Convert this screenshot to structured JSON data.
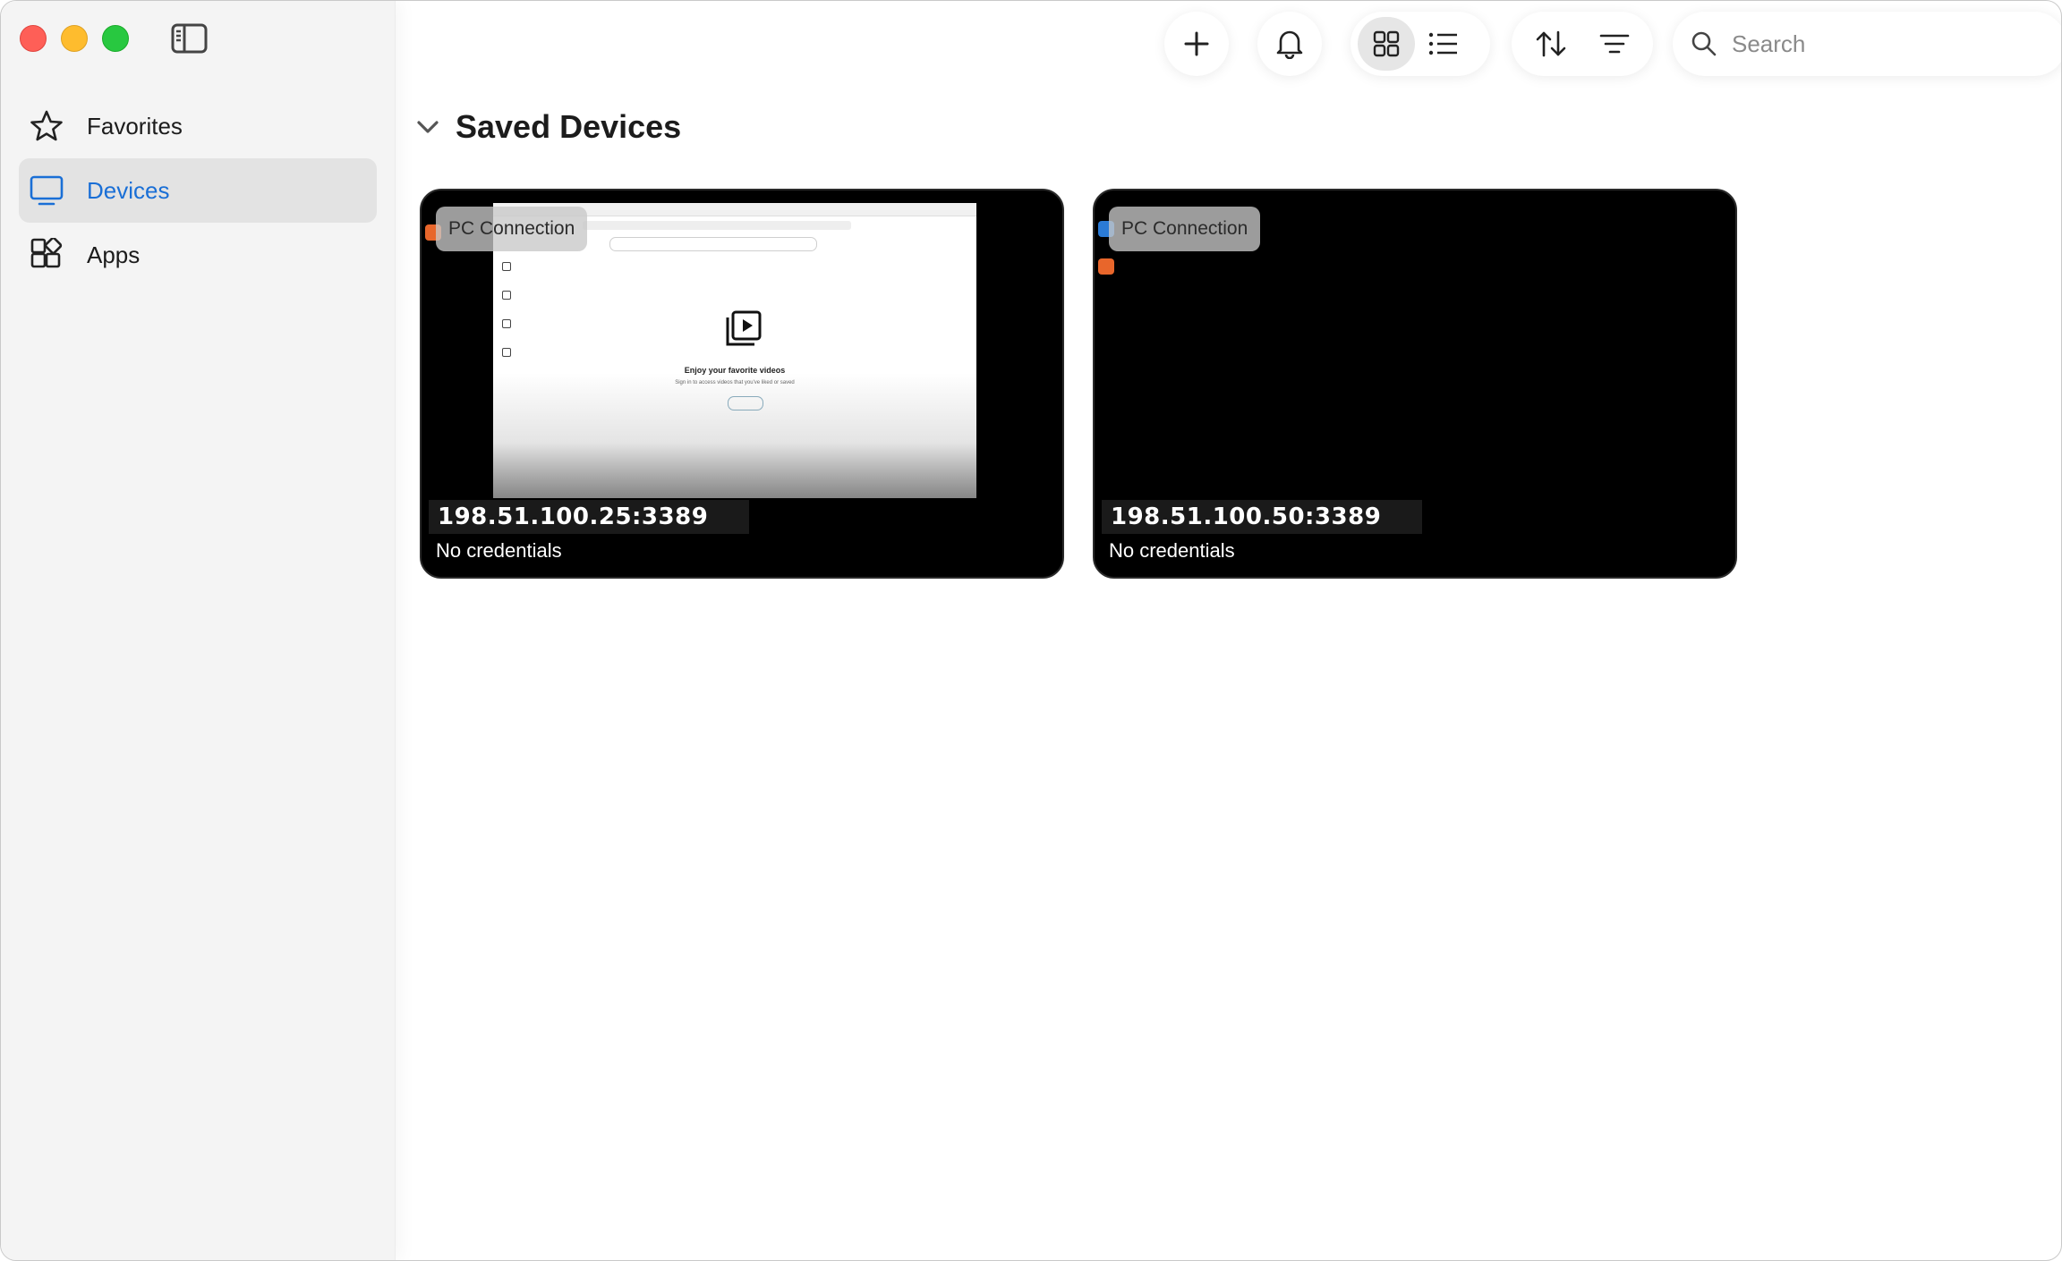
{
  "sidebar": {
    "items": [
      {
        "label": "Favorites",
        "icon": "star-icon",
        "active": false
      },
      {
        "label": "Devices",
        "icon": "monitor-icon",
        "active": true
      },
      {
        "label": "Apps",
        "icon": "apps-grid-icon",
        "active": false
      }
    ]
  },
  "toolbar": {
    "add_icon": "plus-icon",
    "notifications_icon": "bell-icon",
    "view_modes": [
      {
        "icon": "grid-view-icon",
        "selected": true
      },
      {
        "icon": "list-view-icon",
        "selected": false
      }
    ],
    "sort_icon": "sort-arrows-icon",
    "filter_icon": "filter-lines-icon",
    "search": {
      "placeholder": "Search",
      "value": ""
    }
  },
  "main": {
    "section_title": "Saved Devices",
    "devices": [
      {
        "type": "PC Connection",
        "address": "198.51.100.25:3389",
        "credentials": "No credentials",
        "thumbnail": "browser"
      },
      {
        "type": "PC Connection",
        "address": "198.51.100.50:3389",
        "credentials": "No credentials",
        "thumbnail": "desktop"
      }
    ],
    "thumbnail_text": {
      "headline": "Enjoy your favorite videos",
      "subline": "Sign in to access videos that you've liked or saved"
    }
  },
  "colors": {
    "accent": "#1a6fd6",
    "sidebar_bg": "#f4f4f4",
    "active_item_bg": "#e3e3e3",
    "card_bg": "#000000"
  }
}
